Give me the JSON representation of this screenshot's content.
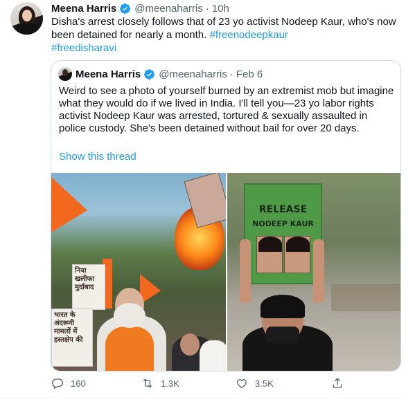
{
  "tweet": {
    "name": "Meena Harris",
    "handle": "@meenaharris",
    "separator": "·",
    "time": "10h",
    "text_plain": "Disha's arrest closely follows that of 23 yo activist Nodeep Kaur, who's now been detained for nearly a month. ",
    "hashtag_1": "#freenodeepkaur",
    "hashtag_2": "#freedisharavi"
  },
  "quote": {
    "name": "Meena Harris",
    "handle": "@meenaharris",
    "separator": "·",
    "date": "Feb 6",
    "text": "Weird to see a photo of yourself burned by an extremist mob but imagine what they would do if we lived in India. I'll tell you—23 yo labor rights activist Nodeep Kaur was arrested, tortured & sexually assaulted in police custody. She's been detained without bail for over 20 days.",
    "show_thread": "Show this thread"
  },
  "photos": {
    "left_signs": {
      "sign_1": "निया खलीफा मुर्दाबाद",
      "sign_2": "भारत के अंदरूनी मामलों में हस्तक्षेप की"
    },
    "right_sign": {
      "line_1": "RELEASE",
      "line_2": "NODEEP KAUR"
    }
  },
  "actions": {
    "replies": "160",
    "retweets": "1.3K",
    "likes": "3.5K"
  },
  "colors": {
    "accent": "#1d9bf0",
    "secondary_text": "#536471",
    "border": "#cfd9de"
  }
}
